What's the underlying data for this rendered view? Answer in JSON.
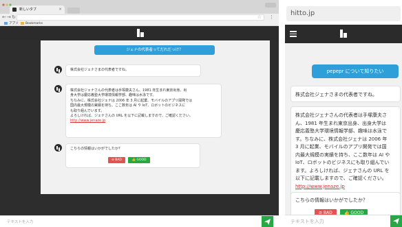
{
  "colors": {
    "accent_blue": "#2e9fd9",
    "bad_red": "#e05454",
    "good_green": "#27a844",
    "header_dark": "#2b2b2b",
    "link_red": "#d32f2f"
  },
  "desktop": {
    "browser": {
      "tab_title": "新しいタブ",
      "tab_close": "×",
      "address": "",
      "bookmarks_label": "アプリ",
      "bookmarks_folder": "Bookmarks"
    },
    "chat": {
      "user_message": "ジェナの代表者ってだれだっけ？",
      "reply1": "株式会社ジェナさまの代表者ですね。",
      "reply2_lines": [
        "株式会社ジェナさんの代表者は手塚康夫さん、1981 年生まれ東京出身。出",
        "身大学は慶応義塾大学環境情報学部、趣味は水泳です。",
        "ちなみに、株式会社ジェナは 2006 年 3 月に起業、モバイルのアプリ開発では",
        "国内最大規模の実績を持ち、ここ数年は AI や IoT、ロボットのビジネスに",
        "も取り組んでいます。",
        "よろしければ、ジェナさんの URL を以下に記載しますので、ご確認ください。"
      ],
      "link": "http://www.jenaze.jp",
      "question": "こちらの情報はいかがでしたか？",
      "bad_label": "BAD",
      "good_label": "GOOD",
      "input_placeholder": "テキストを入力"
    }
  },
  "mobile": {
    "url": "hitto.jp",
    "chat": {
      "user_message": "pepepr について知りたい",
      "reply1": "株式会社ジェナさまの代表者ですね。",
      "reply2_lines": [
        "株式会社ジェナさんの代表者は手塚康夫さ",
        "ん、1981 年生まれ東京出身、出身大学は",
        "慶応義塾大学環境情報学部、趣味は水泳で",
        "す。ちなみに、株式会社ジェナは 2006 年",
        "3 月に起業、モバイルのアプリ開発では国",
        "内最大規模の実績を持ち、ここ数年は AI や",
        "IoT、ロボットのビジネスにも取り組んでい",
        "ます。よろしければ、ジェナさんの URL を",
        "以下に記載しますので、ご確認ください。"
      ],
      "link": "http://www.jenaze.jp",
      "question": "こちらの情報はいかがでしたか？",
      "bad_label": "BAD",
      "good_label": "GOOD",
      "input_placeholder": "テキストを入力"
    }
  }
}
